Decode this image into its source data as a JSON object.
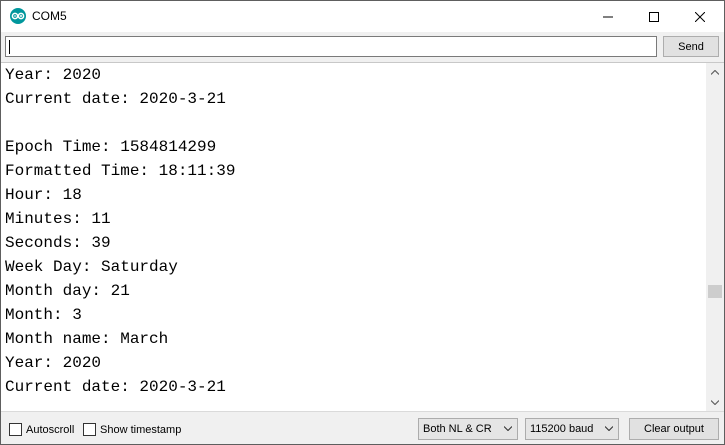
{
  "window": {
    "title": "COM5",
    "icon": "arduino-icon",
    "controls": [
      "minimize-icon",
      "maximize-icon",
      "close-icon"
    ]
  },
  "input": {
    "value": "",
    "placeholder": ""
  },
  "send_label": "Send",
  "output": {
    "lines": [
      "Year: 2020",
      "Current date: 2020-3-21",
      "",
      "Epoch Time: 1584814299",
      "Formatted Time: 18:11:39",
      "Hour: 18",
      "Minutes: 11",
      "Seconds: 39",
      "Week Day: Saturday",
      "Month day: 21",
      "Month: 3",
      "Month name: March",
      "Year: 2020",
      "Current date: 2020-3-21"
    ]
  },
  "bottom": {
    "autoscroll_label": "Autoscroll",
    "autoscroll_checked": false,
    "timestamp_label": "Show timestamp",
    "timestamp_checked": false,
    "line_ending": "Both NL & CR",
    "baud": "115200 baud",
    "clear_label": "Clear output"
  },
  "colors": {
    "arduino": "#00979c",
    "text": "#000000",
    "background": "#ffffff",
    "chrome": "#f0f0f0"
  }
}
